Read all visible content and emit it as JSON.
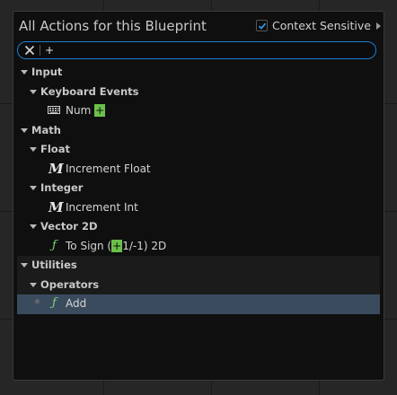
{
  "window": {
    "title": "All Actions for this Blueprint",
    "context_sensitive_label": "Context Sensitive",
    "context_sensitive_checked": true
  },
  "search": {
    "value": "+",
    "placeholder": ""
  },
  "tree": {
    "input": "Input",
    "keyboard_events": "Keyboard Events",
    "num_prefix": "Num ",
    "num_highlight": "+",
    "math": "Math",
    "float": "Float",
    "increment_float": "Increment Float",
    "integer": "Integer",
    "increment_int": "Increment Int",
    "vector2d": "Vector 2D",
    "to_sign_prefix": "To Sign (",
    "to_sign_highlight": "+",
    "to_sign_suffix": "1/-1) 2D",
    "utilities": "Utilities",
    "operators": "Operators",
    "add": "Add"
  },
  "colors": {
    "accent": "#1a7fd3",
    "highlight": "#6bc04a",
    "selected_row": "#3a4b5e",
    "function_icon": "#7ed27e"
  }
}
